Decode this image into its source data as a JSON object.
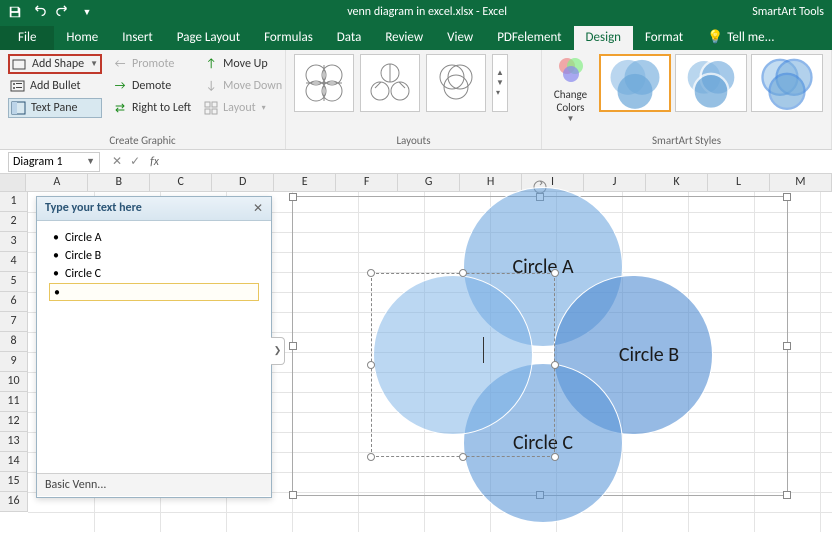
{
  "titlebar": {
    "app_title": "venn diagram in excel.xlsx - Excel",
    "contextual": "SmartArt Tools"
  },
  "tabs": {
    "file": "File",
    "home": "Home",
    "insert": "Insert",
    "pagelayout": "Page Layout",
    "formulas": "Formulas",
    "data": "Data",
    "review": "Review",
    "view": "View",
    "pdfelement": "PDFelement",
    "design": "Design",
    "format": "Format",
    "tellme": "Tell me..."
  },
  "ribbon": {
    "create": {
      "add_shape": "Add Shape",
      "add_bullet": "Add Bullet",
      "text_pane": "Text Pane",
      "promote": "Promote",
      "demote": "Demote",
      "right_to_left": "Right to Left",
      "move_up": "Move Up",
      "move_down": "Move Down",
      "layout": "Layout",
      "group_label": "Create Graphic"
    },
    "layouts": {
      "group_label": "Layouts"
    },
    "change_colors": "Change Colors",
    "styles": {
      "group_label": "SmartArt Styles"
    }
  },
  "namebox": "Diagram 1",
  "fx_label": "fx",
  "columns": [
    "A",
    "B",
    "C",
    "D",
    "E",
    "F",
    "G",
    "H",
    "I",
    "J",
    "K",
    "L",
    "M"
  ],
  "rows": [
    "1",
    "2",
    "3",
    "4",
    "5",
    "6",
    "7",
    "8",
    "9",
    "10",
    "11",
    "12",
    "13",
    "14",
    "15",
    "16"
  ],
  "textpane": {
    "title": "Type your text here",
    "items": [
      "Circle A",
      "Circle B",
      "Circle C"
    ],
    "footer": "Basic Venn..."
  },
  "venn": {
    "a": "Circle A",
    "b": "Circle B",
    "c": "Circle C"
  }
}
